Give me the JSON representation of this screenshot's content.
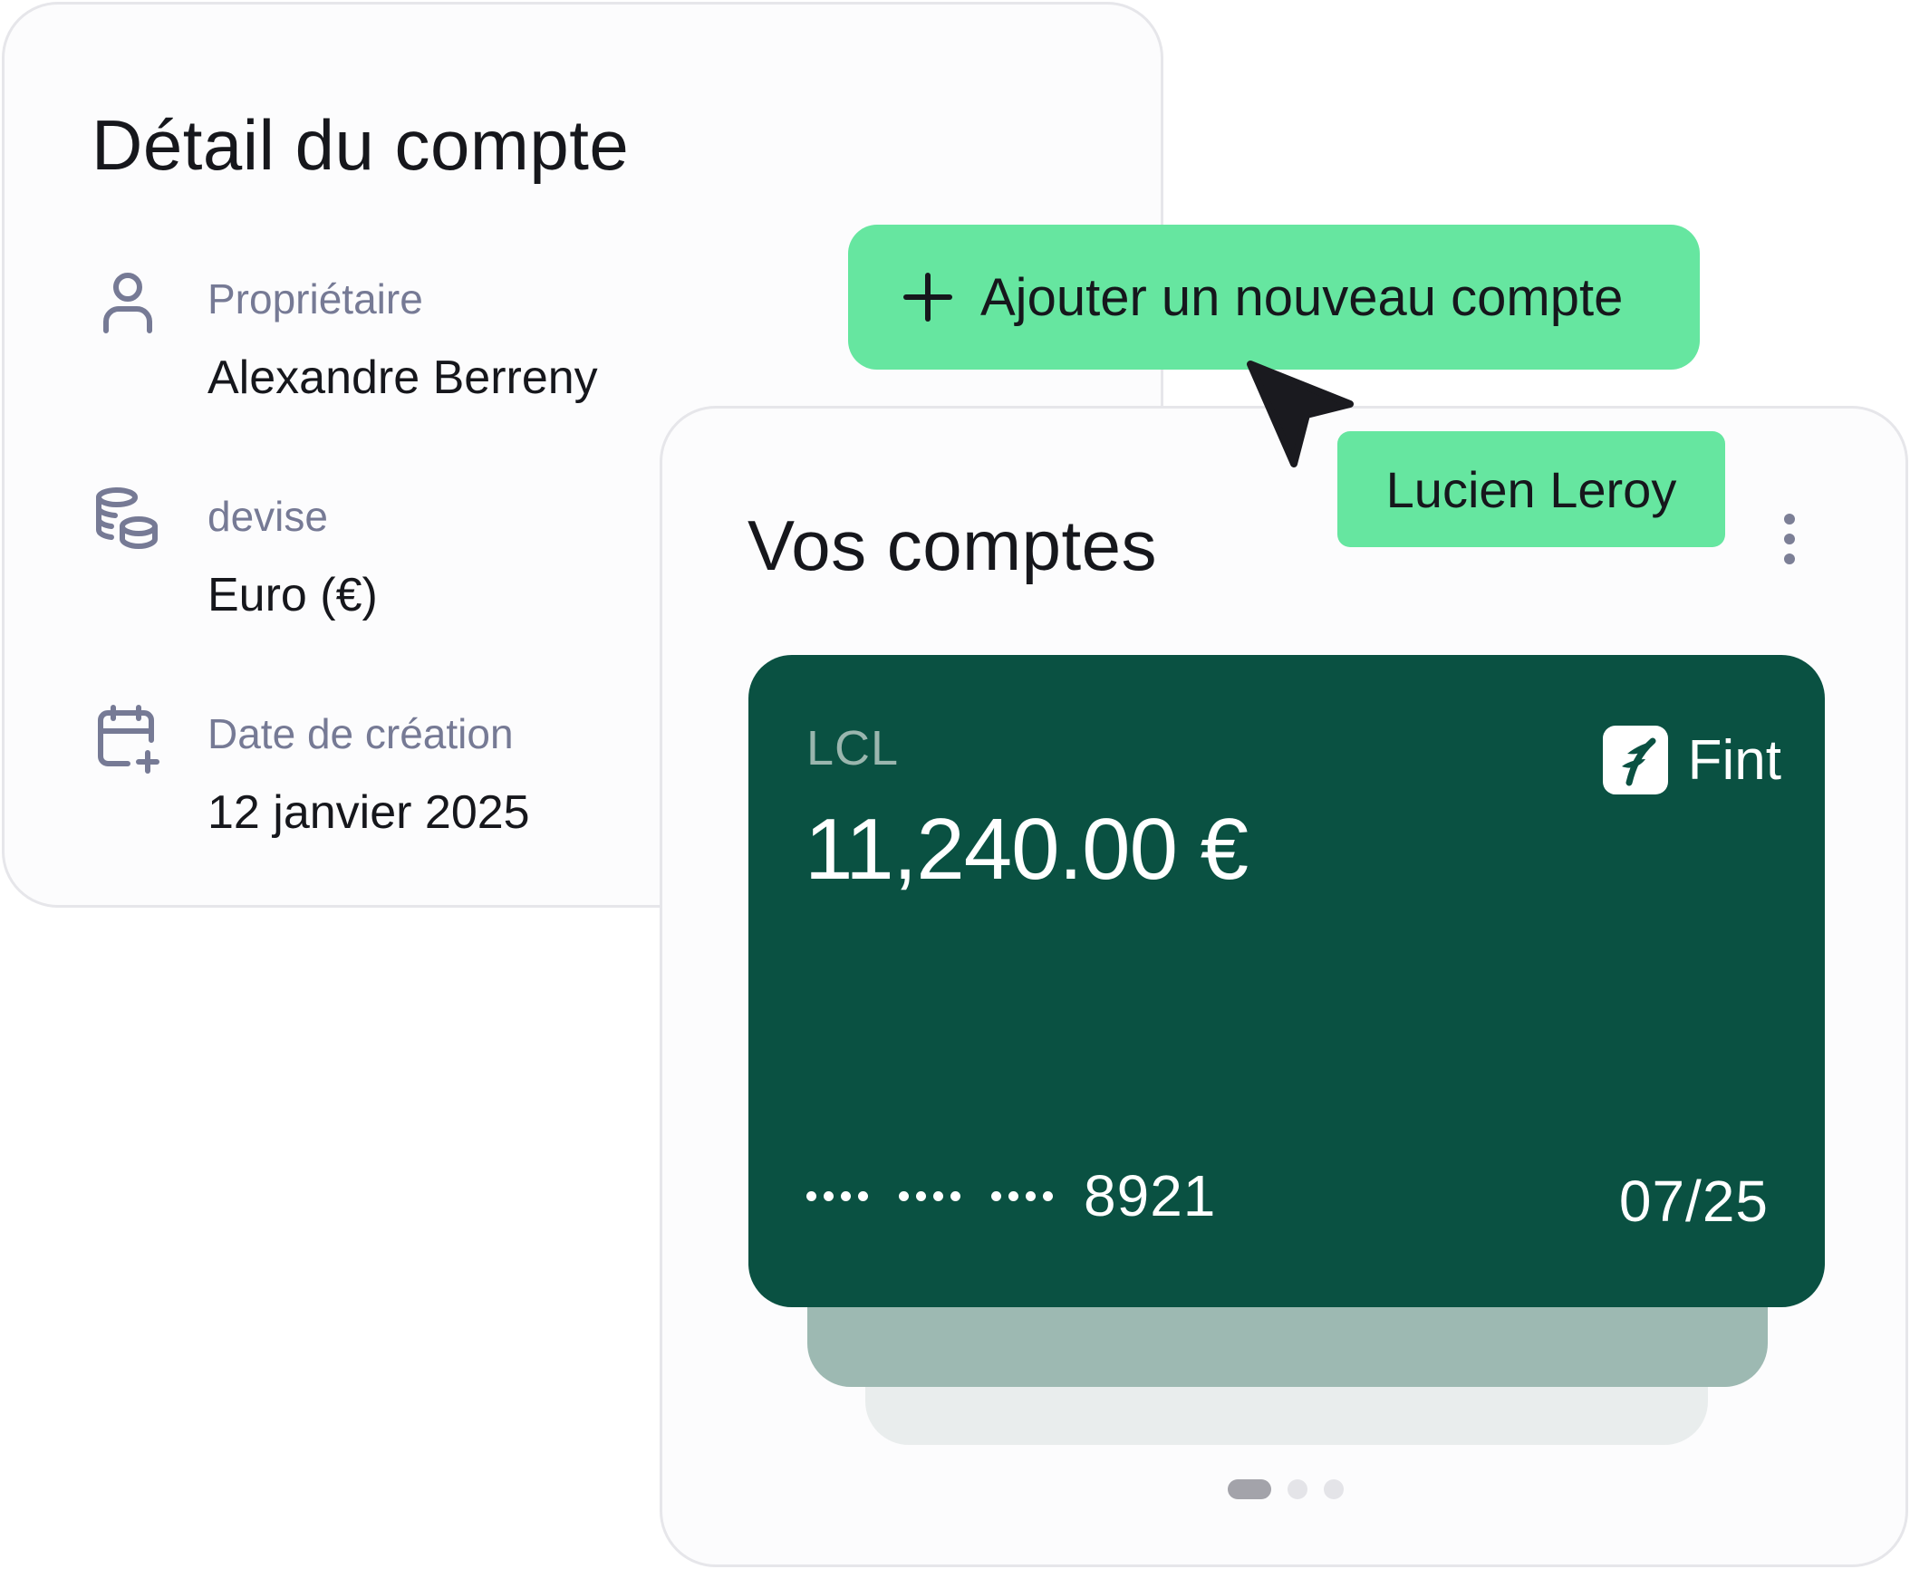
{
  "detail": {
    "title": "Détail du compte",
    "rows": [
      {
        "icon": "user-icon",
        "label": "Propriétaire",
        "value": "Alexandre Berreny"
      },
      {
        "icon": "coins-icon",
        "label": "devise",
        "value": "Euro (€)"
      },
      {
        "icon": "calendar-plus-icon",
        "label": "Date de création",
        "value": "12 janvier 2025"
      }
    ]
  },
  "add_account": {
    "icon": "plus-icon",
    "label": "Ajouter un nouveau compte"
  },
  "collaborator": {
    "name": "Lucien Leroy",
    "cursor_icon": "cursor-arrow-icon"
  },
  "accounts": {
    "title": "Vos comptes",
    "menu_icon": "more-vertical-icon",
    "card": {
      "bank": "LCL",
      "balance": "11,240.00 €",
      "brand": "Fint",
      "brand_icon": "fint-logo-icon",
      "masked_groups": 3,
      "last4": "8921",
      "expiry": "07/25"
    },
    "pagination": {
      "total": 3,
      "active": 1
    }
  },
  "colors": {
    "accent_green": "#66e6a0",
    "card_green": "#0a5142",
    "muted_text": "#767a95",
    "text": "#16171c"
  }
}
